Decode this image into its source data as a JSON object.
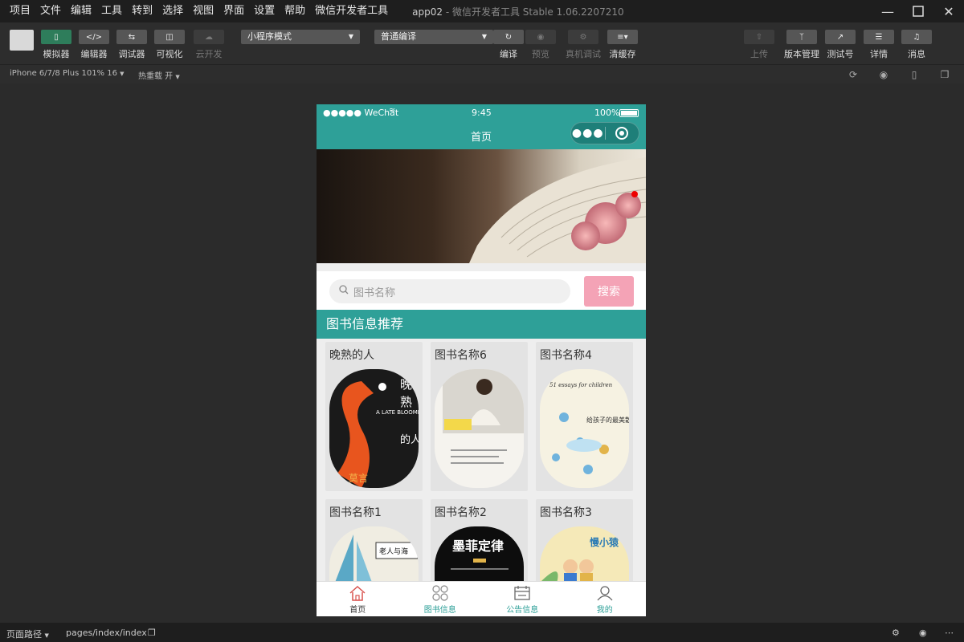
{
  "menu": [
    "项目",
    "文件",
    "编辑",
    "工具",
    "转到",
    "选择",
    "视图",
    "界面",
    "设置",
    "帮助",
    "微信开发者工具"
  ],
  "window": {
    "title": "app02",
    "subtitle": " - 微信开发者工具 Stable 1.06.2207210"
  },
  "toolbar": {
    "simulator": "模拟器",
    "editor": "编辑器",
    "debugger": "调试器",
    "visual": "可视化",
    "cloud": "云开发",
    "mode_select": "小程序模式",
    "compile_select": "普通编译",
    "compile": "编译",
    "preview": "预览",
    "remote_debug": "真机调试",
    "clear_cache": "清缓存",
    "upload": "上传",
    "version": "版本管理",
    "test_id": "测试号",
    "details": "详情",
    "messages": "消息"
  },
  "subbar": {
    "device": "iPhone 6/7/8 Plus 101% 16",
    "hot_reload": "热重载 开"
  },
  "status": {
    "path_label": "页面路径",
    "path": "pages/index/index"
  },
  "phone": {
    "carrier": "●●●●● WeChat",
    "time": "9:45",
    "battery": "100%",
    "nav_title": "首页",
    "search_placeholder": "图书名称",
    "search_button": "搜索",
    "section_title": "图书信息推荐",
    "books": [
      {
        "title": "晚熟的人"
      },
      {
        "title": "图书名称6"
      },
      {
        "title": "图书名称4"
      },
      {
        "title": "图书名称1"
      },
      {
        "title": "图书名称2"
      },
      {
        "title": "图书名称3"
      }
    ],
    "covers": {
      "b1_a": "晚",
      "b1_b": "熟",
      "b1_c": "的人",
      "b1_en": "A LATE BLOOMER",
      "b1_author": "莫言",
      "b3_en": "51 essays for children",
      "b3_cn": "给孩子的最美散文",
      "b4_cn": "老人与海",
      "b5_cn": "墨菲定律",
      "b6_cn": "慢小猿"
    },
    "tabs": [
      {
        "label": "首页"
      },
      {
        "label": "图书信息"
      },
      {
        "label": "公告信息"
      },
      {
        "label": "我的"
      }
    ]
  },
  "colors": {
    "teal": "#2ea098",
    "pink_button": "#f4a3b6",
    "tab_active": "#d9534f"
  }
}
